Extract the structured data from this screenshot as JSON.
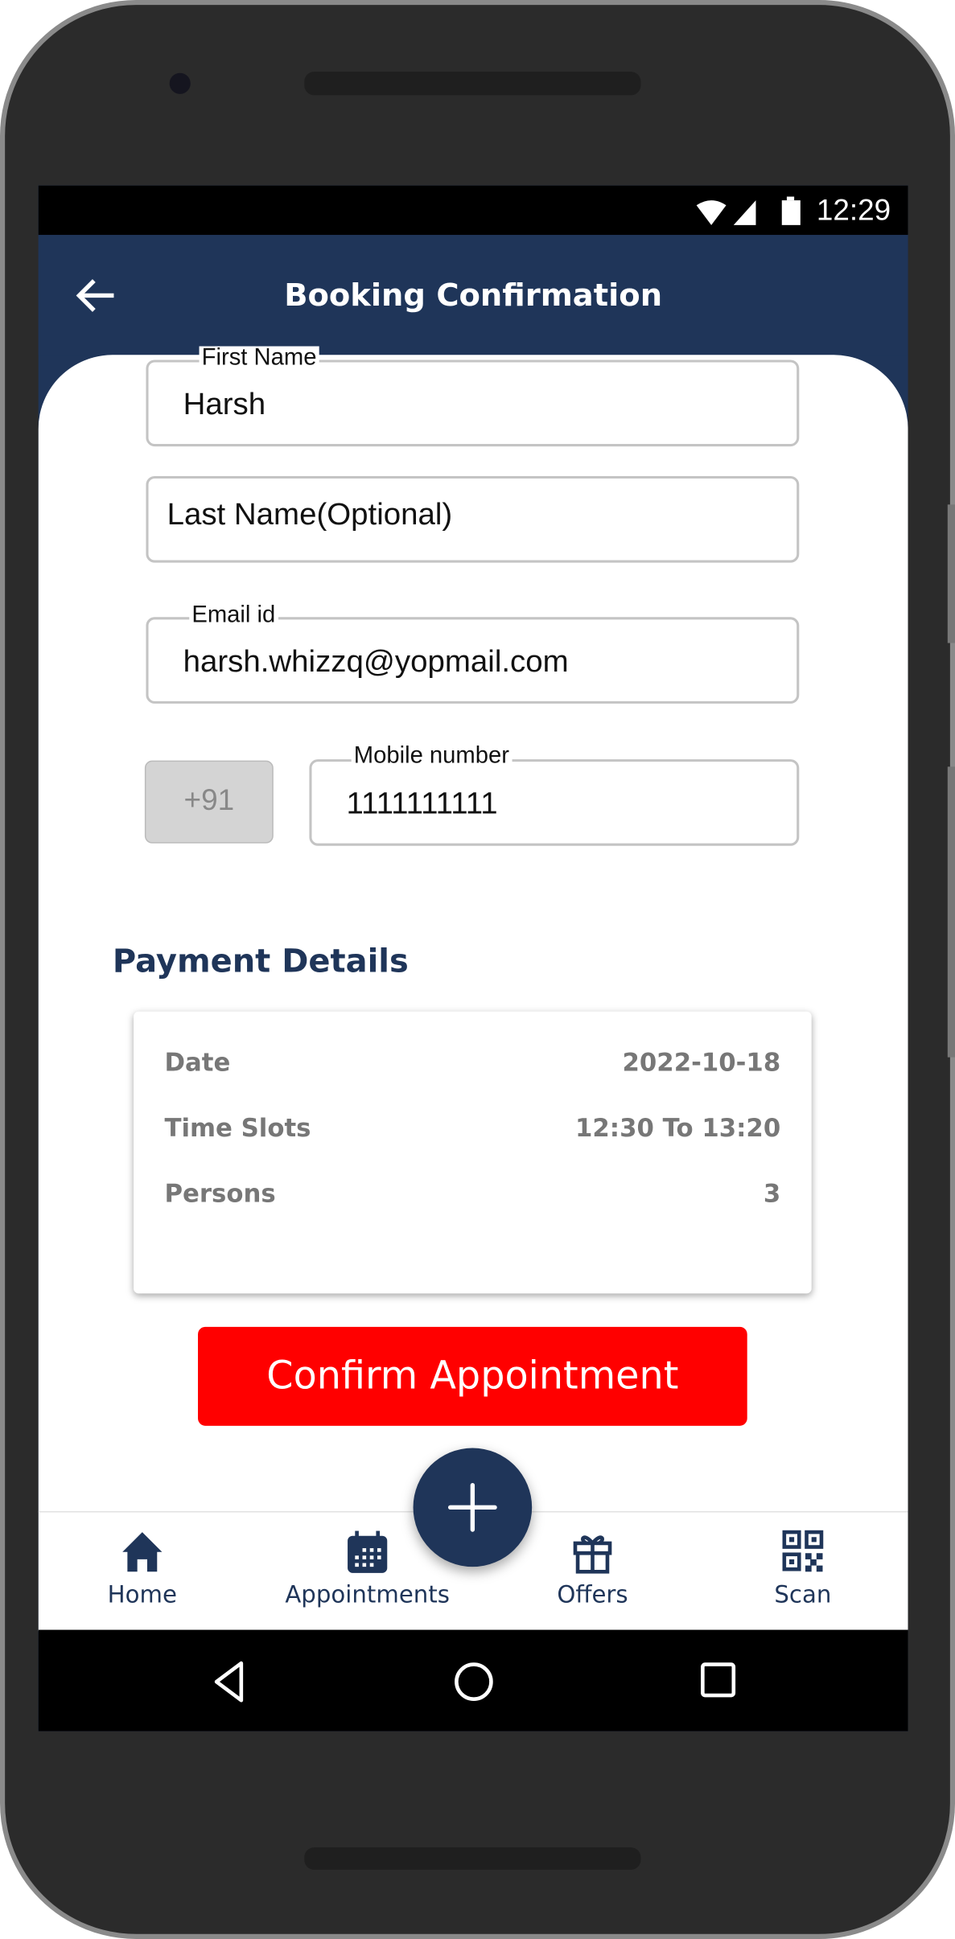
{
  "status_bar": {
    "time": "12:29"
  },
  "app_bar": {
    "title": "Booking Confirmation"
  },
  "form": {
    "first_name": {
      "label": "First Name",
      "value": "Harsh"
    },
    "last_name": {
      "placeholder": "Last Name(Optional)",
      "value": ""
    },
    "email": {
      "label": "Email id",
      "value": "harsh.whizzq@yopmail.com"
    },
    "country_code": "+91",
    "mobile": {
      "label": "Mobile number",
      "value": "1111111111"
    }
  },
  "payment": {
    "heading": "Payment Details",
    "rows": [
      {
        "label": "Date",
        "value": "2022-10-18"
      },
      {
        "label": "Time Slots",
        "value": "12:30 To 13:20"
      },
      {
        "label": "Persons",
        "value": "3"
      }
    ]
  },
  "confirm_button": "Confirm Appointment",
  "bottom_nav": {
    "items": [
      {
        "label": "Home",
        "icon": "home-icon"
      },
      {
        "label": "Appointments",
        "icon": "calendar-icon"
      },
      {
        "label": "Offers",
        "icon": "gift-icon"
      },
      {
        "label": "Scan",
        "icon": "qr-code-icon"
      }
    ],
    "fab_icon": "plus-icon"
  },
  "colors": {
    "primary": "#1f3559",
    "button": "#ff0000",
    "muted": "#777777"
  }
}
